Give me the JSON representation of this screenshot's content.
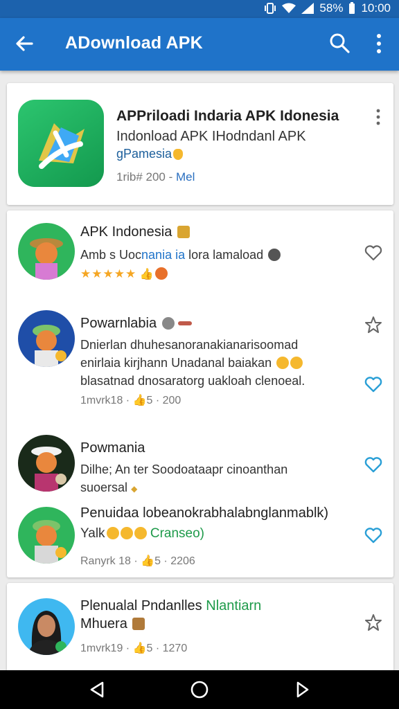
{
  "status_bar": {
    "battery_percent": "58%",
    "time": "10:00",
    "icons": [
      "vibrate-icon",
      "wifi-icon",
      "signal-icon"
    ]
  },
  "app_bar": {
    "title": "ADownload APK",
    "icons": [
      "back-arrow-icon",
      "search-icon",
      "more-vert-icon"
    ]
  },
  "featured": {
    "title": "APPriloadi Indaria APK Idonesia",
    "subtitle": "Indonload APK IHodndanl APK",
    "subtitle2": "gPamesia",
    "meta_prefix": "1rib# 200 - ",
    "meta_tag": "Mel"
  },
  "items": [
    {
      "name": "APK Indonesia",
      "desc_parts": [
        "Amb s Uoc",
        "nania ia",
        " lora lamaload"
      ],
      "rating": "★★★★★",
      "action": "heart-icon"
    },
    {
      "name": "Powarnlabia",
      "lines": [
        "Dnierlan dhuhesanoranakianarisoomad",
        "enirlaia kirjhann Unadanal baiakan",
        "blasatnad dnosaratorg uakloah clenoeal."
      ],
      "meta_prefix": "1mvrk18 · ",
      "meta_count": "200",
      "action": "star-outline-icon",
      "action2": "heart-icon"
    },
    {
      "name": "Powmania",
      "lines": [
        "Dilhe; An ter Soodoataapr cinoanthan",
        "suoersal"
      ],
      "action": "heart-icon"
    },
    {
      "name": "Penuidaa lobeanokrabhalabnglanmablk)",
      "line2_prefix": "Yalk",
      "line2_suffix": "Cranseo)",
      "meta_prefix": "Ranyrk 18 · ",
      "meta_count": "2206",
      "action": "heart-icon"
    }
  ],
  "bottom_item": {
    "name": "Plenualal Pndanlles ",
    "name_tag": "Nlantiarn",
    "line2": "Mhuera",
    "meta_prefix": "1mvrk19 · ",
    "meta_count": "1270",
    "action": "star-outline-icon"
  },
  "nav_bar": {
    "icons": [
      "back-triangle-icon",
      "home-circle-icon",
      "recents-icon"
    ]
  },
  "colors": {
    "status_bar": "#1c62ad",
    "app_bar": "#1f73c9",
    "accent_heart": "#2a9fd6",
    "background": "#ececec"
  }
}
